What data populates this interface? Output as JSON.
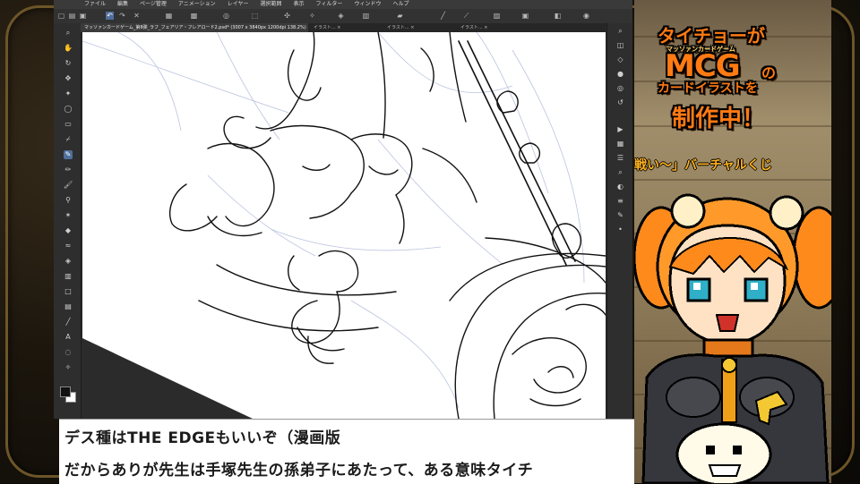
{
  "app": {
    "menu": [
      "ファイル",
      "編集",
      "ページ管理",
      "アニメーション",
      "レイヤー",
      "選択範囲",
      "表示",
      "フィルター",
      "ウィンドウ",
      "ヘルプ"
    ]
  },
  "tabs": [
    {
      "label": "マッソァンカードゲーム_第8弾_ラフ_フェアリア・フレアロード2.psd* (3007 x 3840px 1200dpi 138.2%)",
      "active": true
    },
    {
      "label": "イラスト... ×",
      "active": false
    },
    {
      "label": "イラスト... ×",
      "active": false
    },
    {
      "label": "イラスト... ×",
      "active": false
    }
  ],
  "tools": [
    {
      "icon": "zoom-icon",
      "glyph": "⌕"
    },
    {
      "icon": "hand-icon",
      "glyph": "✋"
    },
    {
      "icon": "rotate-icon",
      "glyph": "↻"
    },
    {
      "icon": "move-icon",
      "glyph": "✥"
    },
    {
      "icon": "wand-icon",
      "glyph": "✦"
    },
    {
      "icon": "lasso-icon",
      "glyph": "◯"
    },
    {
      "icon": "selection-icon",
      "glyph": "▭"
    },
    {
      "icon": "eyedropper-icon",
      "glyph": "⌿"
    },
    {
      "icon": "pen-icon",
      "glyph": "✎"
    },
    {
      "icon": "pencil-icon",
      "glyph": "✏"
    },
    {
      "icon": "brush-icon",
      "glyph": "🖌"
    },
    {
      "icon": "airbrush-icon",
      "glyph": "⚲"
    },
    {
      "icon": "decoration-icon",
      "glyph": "✶"
    },
    {
      "icon": "eraser-icon",
      "glyph": "◆"
    },
    {
      "icon": "blend-icon",
      "glyph": "≈"
    },
    {
      "icon": "fill-icon",
      "glyph": "◈"
    },
    {
      "icon": "gradient-icon",
      "glyph": "▥"
    },
    {
      "icon": "figure-icon",
      "glyph": "□"
    },
    {
      "icon": "frame-icon",
      "glyph": "▤"
    },
    {
      "icon": "ruler-icon",
      "glyph": "╱"
    },
    {
      "icon": "text-icon",
      "glyph": "A"
    },
    {
      "icon": "balloon-icon",
      "glyph": "◌"
    },
    {
      "icon": "correct-line-icon",
      "glyph": "✧"
    }
  ],
  "right_tools": [
    {
      "icon": "navigator-icon",
      "glyph": "⌕"
    },
    {
      "icon": "sub-view-icon",
      "glyph": "◫"
    },
    {
      "icon": "material-icon",
      "glyph": "◇"
    },
    {
      "icon": "color-icon",
      "glyph": "●"
    },
    {
      "icon": "layer-property-icon",
      "glyph": "◎"
    },
    {
      "icon": "history-icon",
      "glyph": "↺"
    },
    {
      "icon": "auto-action-icon",
      "glyph": "▶"
    },
    {
      "icon": "item-bank-icon",
      "glyph": "▦"
    },
    {
      "icon": "layers-icon",
      "glyph": "☰"
    },
    {
      "icon": "search-layer-icon",
      "glyph": "⌕"
    },
    {
      "icon": "animation-icon",
      "glyph": "◐"
    },
    {
      "icon": "color-slider-icon",
      "glyph": "≡"
    },
    {
      "icon": "tool-property-icon",
      "glyph": "✎"
    },
    {
      "icon": "brush-size-icon",
      "glyph": "•"
    }
  ],
  "subtitle": {
    "line1": "デス種はTHE EDGEもいいぞ（漫画版",
    "line2": "だからありが先生は手塚先生の孫弟子にあたって、ある意味タイチ"
  },
  "side_panel": {
    "title_line1": "タイチョーが",
    "title_small": "マッソァンカードゲーム",
    "title_line2": "MCG",
    "title_line2_suffix": "の",
    "title_line3": "カードイラストを",
    "title_line4": "制作中！",
    "ticker": "戦い〜」バーチャルくじ"
  },
  "colors": {
    "accent_orange": "#ff7a12",
    "frame_gold": "#6d5528",
    "active_tool": "#4f6f9a"
  }
}
